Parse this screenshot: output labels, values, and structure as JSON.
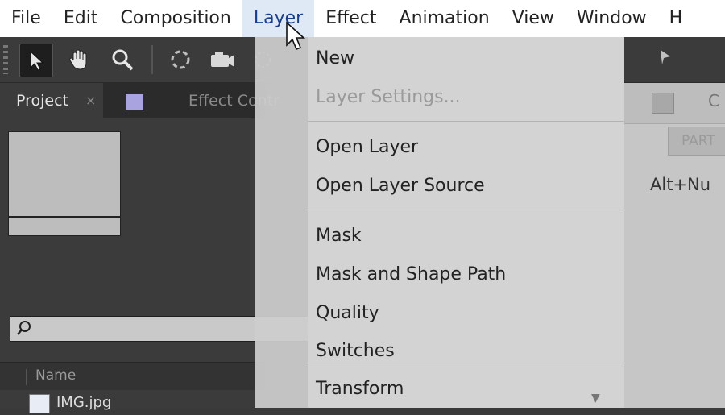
{
  "menubar": {
    "items": [
      "File",
      "Edit",
      "Composition",
      "Layer",
      "Effect",
      "Animation",
      "View",
      "Window",
      "H"
    ],
    "active_index": 3
  },
  "toolbar": {
    "tools": [
      "selection-icon",
      "hand-icon",
      "zoom-icon",
      "rotate-icon",
      "camera-icon",
      "pan-behind-icon"
    ]
  },
  "project_panel": {
    "tab_label": "Project",
    "tab_close": "×",
    "effect_tab_label": "Effect Contr",
    "search_icon": "search-icon",
    "column_name": "Name",
    "file_name": "IMG.jpg"
  },
  "layer_menu": {
    "items": [
      {
        "label": "New",
        "enabled": true
      },
      {
        "label": "Layer Settings...",
        "enabled": false
      },
      {
        "label": "Open Layer",
        "enabled": true
      },
      {
        "label": "Open Layer Source",
        "enabled": true
      },
      {
        "label": "Mask",
        "enabled": true
      },
      {
        "label": "Mask and Shape Path",
        "enabled": true
      },
      {
        "label": "Quality",
        "enabled": true
      },
      {
        "label": "Switches",
        "enabled": true
      },
      {
        "label": "Transform",
        "enabled": true
      }
    ]
  },
  "right_panel": {
    "heading_letter": "C",
    "tab_label": "PART",
    "hotkey": "Alt+Nu"
  },
  "colors": {
    "menubar_bg": "#ffffff",
    "menubar_active": "#dfe9f5",
    "dropdown_bg": "#d3d3d3",
    "panel_bg": "#3b3b3b",
    "swatch": "#a9a3df"
  }
}
